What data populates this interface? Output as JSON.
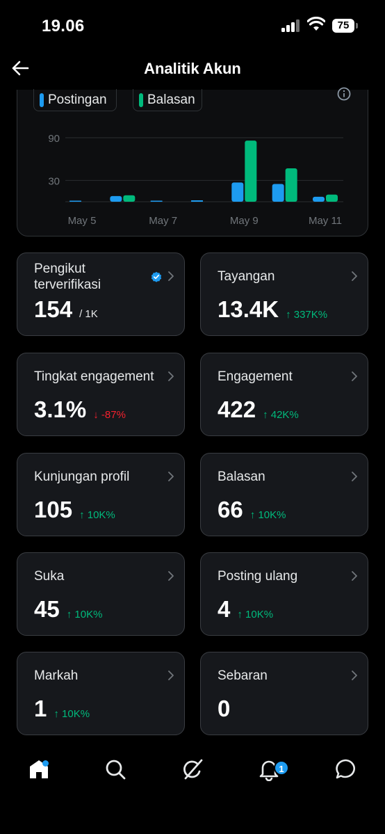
{
  "status": {
    "time": "19.06",
    "battery": "75"
  },
  "header": {
    "title": "Analitik Akun"
  },
  "legend": [
    {
      "label": "Postingan",
      "color": "#1d9bf0"
    },
    {
      "label": "Balasan",
      "color": "#00ba7c"
    }
  ],
  "chart_data": {
    "type": "bar",
    "categories": [
      "May 5",
      "May 6",
      "May 7",
      "May 8",
      "May 9",
      "May 10",
      "May 11"
    ],
    "x_tick_labels": [
      "May 5",
      "May 7",
      "May 9",
      "May 11"
    ],
    "y_ticks": [
      "90",
      "30"
    ],
    "ylim": [
      0,
      100
    ],
    "series": [
      {
        "name": "Postingan",
        "color": "#1d9bf0",
        "values": [
          1,
          8,
          1,
          2,
          27,
          25,
          7
        ]
      },
      {
        "name": "Balasan",
        "color": "#00ba7c",
        "values": [
          0,
          9,
          0,
          0,
          86,
          47,
          10
        ]
      }
    ]
  },
  "stats": [
    {
      "label": "Pengikut terverifikasi",
      "value": "154",
      "sub": "/ 1K",
      "change": "",
      "dir": "none",
      "verified": true
    },
    {
      "label": "Tayangan",
      "value": "13.4K",
      "sub": "",
      "change": "↑ 337K%",
      "dir": "up"
    },
    {
      "label": "Tingkat engagement",
      "value": "3.1%",
      "sub": "",
      "change": "↓ -87%",
      "dir": "down"
    },
    {
      "label": "Engagement",
      "value": "422",
      "sub": "",
      "change": "↑ 42K%",
      "dir": "up"
    },
    {
      "label": "Kunjungan profil",
      "value": "105",
      "sub": "",
      "change": "↑ 10K%",
      "dir": "up"
    },
    {
      "label": "Balasan",
      "value": "66",
      "sub": "",
      "change": "↑ 10K%",
      "dir": "up"
    },
    {
      "label": "Suka",
      "value": "45",
      "sub": "",
      "change": "↑ 10K%",
      "dir": "up"
    },
    {
      "label": "Posting ulang",
      "value": "4",
      "sub": "",
      "change": "↑ 10K%",
      "dir": "up"
    },
    {
      "label": "Markah",
      "value": "1",
      "sub": "",
      "change": "↑ 10K%",
      "dir": "up"
    },
    {
      "label": "Sebaran",
      "value": "0",
      "sub": "",
      "change": "",
      "dir": "none"
    }
  ],
  "nav": {
    "notifications_badge": "1",
    "items": [
      "home-icon",
      "search-icon",
      "grok-icon",
      "notifications-icon",
      "messages-icon"
    ]
  }
}
